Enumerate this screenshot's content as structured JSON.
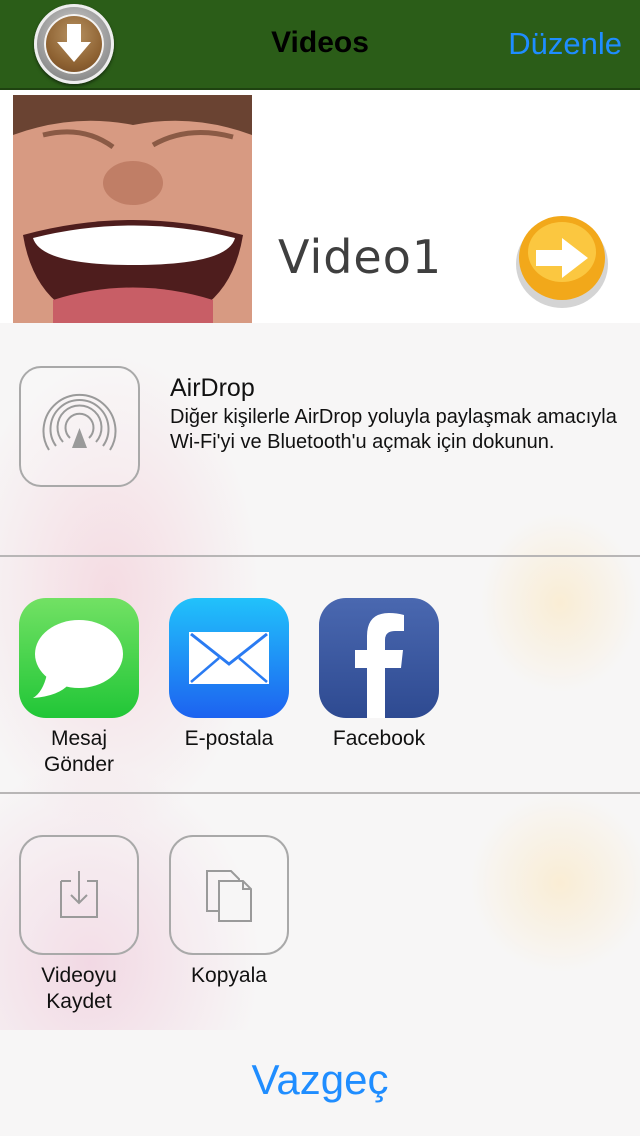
{
  "nav": {
    "title": "Videos",
    "edit_label": "Düzenle",
    "bar_color": "#2b5d18",
    "link_color": "#1f8dff"
  },
  "video": {
    "title": "Video1",
    "play_icon": "orange-arrow-icon"
  },
  "share": {
    "airdrop": {
      "title": "AirDrop",
      "description": "Diğer kişilerle AirDrop yoluyla paylaşmak amacıyla Wi-Fi'yi ve Bluetooth'u açmak için dokunun."
    },
    "apps": [
      {
        "label": "Mesaj\nGönder",
        "icon": "messages-icon"
      },
      {
        "label": "E-postala",
        "icon": "mail-icon"
      },
      {
        "label": "Facebook",
        "icon": "facebook-icon"
      }
    ],
    "actions": [
      {
        "label": "Videoyu\nKaydet",
        "icon": "save-video-icon"
      },
      {
        "label": "Kopyala",
        "icon": "copy-icon"
      }
    ],
    "cancel_label": "Vazgeç"
  }
}
